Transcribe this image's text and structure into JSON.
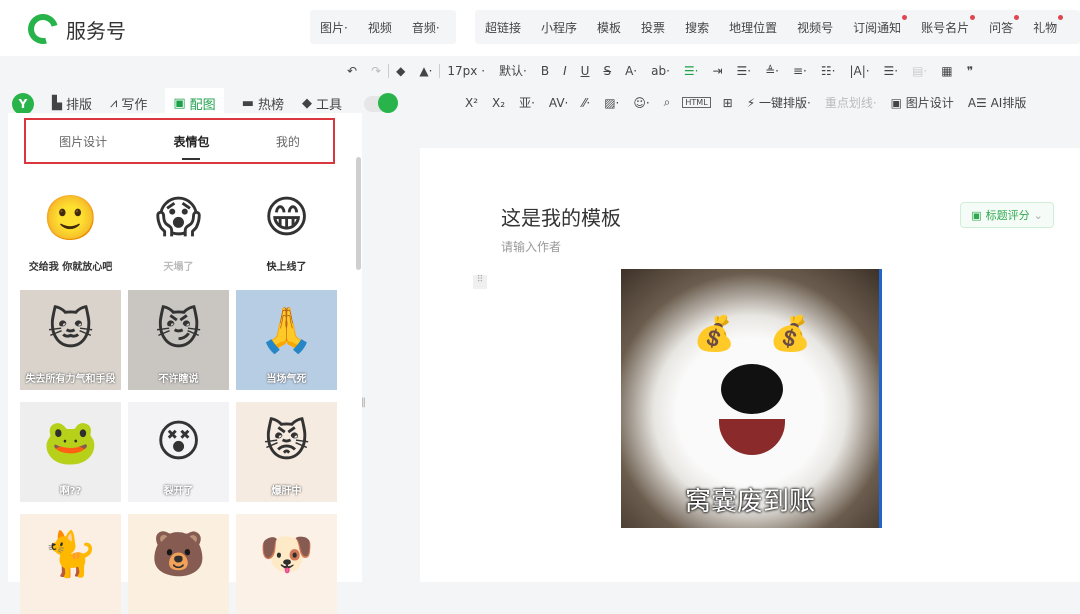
{
  "app": {
    "name": "服务号"
  },
  "menu_group1": [
    "图片·",
    "视频",
    "音频·"
  ],
  "menu_group2": [
    {
      "label": "超链接",
      "dot": false
    },
    {
      "label": "小程序",
      "dot": false
    },
    {
      "label": "模板",
      "dot": false
    },
    {
      "label": "投票",
      "dot": false
    },
    {
      "label": "搜索",
      "dot": false
    },
    {
      "label": "地理位置",
      "dot": false
    },
    {
      "label": "视频号",
      "dot": false
    },
    {
      "label": "订阅通知",
      "dot": true
    },
    {
      "label": "账号名片",
      "dot": true
    },
    {
      "label": "问答",
      "dot": true
    },
    {
      "label": "礼物",
      "dot": true
    }
  ],
  "toolbar1": {
    "undo": "↶",
    "redo": "↷",
    "eraser": "◆",
    "brush": "▲·",
    "font_size": "17px ·",
    "font": "默认·",
    "bold": "B",
    "italic": "I",
    "underline": "U",
    "strike": "S",
    "color": "A·",
    "bg": "ab·",
    "align_center": "☰·",
    "i1": "⇥",
    "i2": "☰·",
    "i3": "≜·",
    "i4": "≡·",
    "i5": "☷·",
    "i6": "|A|·",
    "i7": "☰·",
    "i8": "▤·",
    "table": "▦",
    "quote": "❞"
  },
  "toolbar2": {
    "sup": "X²",
    "sub": "X₂",
    "t1": "亚·",
    "t2": "AV·",
    "t3": "⁄⁄·",
    "t4": "▨·",
    "emoji": "☺·",
    "t5": "⌕",
    "html": "HTML",
    "t6": "⊞",
    "one_click": "一键排版·",
    "highlight": "重点划线·",
    "img_design": "图片设计",
    "ai": "AI排版"
  },
  "nav": {
    "logo": "Y",
    "items": [
      "排版",
      "写作",
      "配图",
      "热榜",
      "工具"
    ],
    "active": 2
  },
  "panel": {
    "tabs": [
      "图片设计",
      "表情包",
      "我的"
    ],
    "active": 1,
    "stickers": [
      {
        "emoji": "🙂",
        "caption": "交给我 你就放心吧",
        "bg": "#ffffff",
        "color": "#333"
      },
      {
        "emoji": "😱",
        "caption": "天塌了",
        "bg": "#ffffff",
        "color": "#bbb"
      },
      {
        "emoji": "😁",
        "caption": "快上线了",
        "bg": "#ffffff",
        "color": "#333"
      },
      {
        "emoji": "🐱",
        "caption": "失去所有力气和手段",
        "bg": "#d9d3cc",
        "color": "#fff"
      },
      {
        "emoji": "😼",
        "caption": "不许瞎说",
        "bg": "#c9c6c2",
        "color": "#fff"
      },
      {
        "emoji": "🙏",
        "caption": "当场气死",
        "bg": "#b7cde4",
        "color": "#fff"
      },
      {
        "emoji": "🐸",
        "caption": "啊??",
        "bg": "#eeeeee",
        "color": "#fff"
      },
      {
        "emoji": "😵",
        "caption": "裂开了",
        "bg": "#f3f3f5",
        "color": "#fff"
      },
      {
        "emoji": "😾",
        "caption": "爆肝中",
        "bg": "#f6ebe1",
        "color": "#fff"
      },
      {
        "emoji": "🐈",
        "caption": "",
        "bg": "#fbeee2",
        "color": "#fff"
      },
      {
        "emoji": "🐻",
        "caption": "",
        "bg": "#fbf0e0",
        "color": "#fff"
      },
      {
        "emoji": "🐶",
        "caption": "",
        "bg": "#fbf1e6",
        "color": "#fff"
      }
    ]
  },
  "editor": {
    "title": "这是我的模板",
    "author_placeholder": "请输入作者",
    "score_button": "标题评分",
    "image_caption": "窝囊废到账",
    "eye": "💰"
  }
}
